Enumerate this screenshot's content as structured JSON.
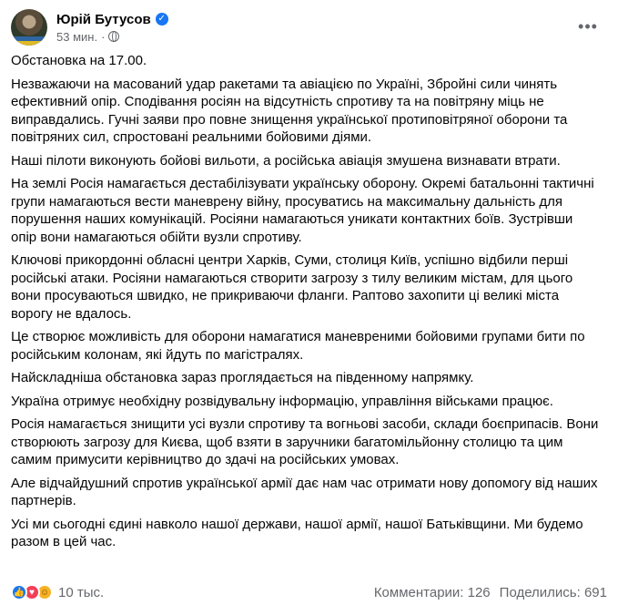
{
  "header": {
    "author": "Юрій Бутусов",
    "time": "53 мин.",
    "separator": "·",
    "more_icon": "more-horizontal-icon",
    "verified_icon": "verified-badge-icon",
    "privacy_icon": "globe-icon"
  },
  "paragraphs": [
    "Обстановка на 17.00.",
    "Незважаючи на масований удар ракетами та авіацією по Україні, Збройні сили чинять\nефективний опір. Сподівання росіян на відсутність спротиву та на повітряну міць не\nвиправдались. Гучні заяви про повне знищення української протиповітряної оборони та\nповітряних сил, спростовані реальними бойовими діями.",
    "Наші пілоти виконують бойові вильоти, а російська авіація змушена визнавати втрати.",
    "На землі Росія намагається дестабілізувати українську оборону. Окремі батальонні тактичні\nгрупи намагаються вести маневрену війну, просуватись на максимальну дальність для\nпорушення наших комунікацій. Росіяни намагаються уникати контактних боїв. Зустрівши\nопір вони намагаються обійти вузли спротиву.",
    "Ключові прикордонні обласні центри Харків, Суми, столиця Київ, успішно відбили перші\nросійські атаки. Росіяни намагаються створити загрозу з тилу великим містам, для цього\nвони просуваються швидко, не прикриваючи фланги. Раптово захопити ці великі міста\nворогу не вдалось.",
    "Це створює можливість для оборони намагатися маневреними бойовими групами бити по\nросійським колонам, які йдуть по магістралях.",
    "Найскладніша обстановка зараз проглядається на південному напрямку.",
    "Україна отримує необхідну розвідувальну інформацію, управління військами працює.",
    "Росія намагається знищити усі вузли спротиву та вогньові засоби, склади боєприпасів. Вони\nстворюють загрозу для Києва, щоб взяти в заручники багатомільйонну столицю та цим\nсамим примусити керівництво до здачі на російських умовах.",
    "Але відчайдушний спротив української армії дає нам час отримати нову допомогу від наших\nпартнерів.",
    "Усі ми сьогодні єдині навколо нашої держави, нашої армії, нашої Батьківщини. Ми будемо\nразом в цей час."
  ],
  "footer": {
    "reaction_icons": [
      "like-icon",
      "love-icon",
      "care-icon"
    ],
    "reaction_count": "10 тыс.",
    "comments": "Комментарии: 126",
    "shares": "Поделились: 691"
  }
}
